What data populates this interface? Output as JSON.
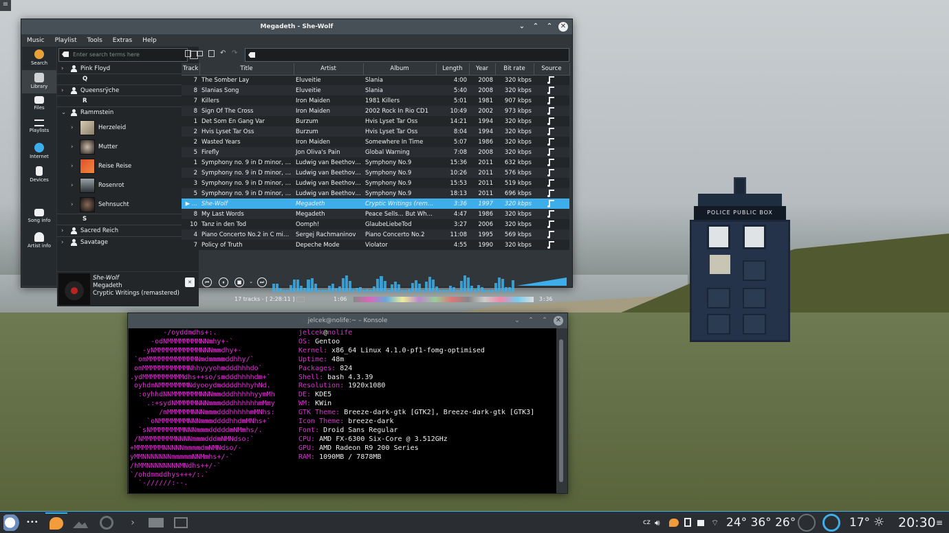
{
  "desktop": {
    "corner_menu": "≡"
  },
  "tardis": {
    "sign": "POLICE PUBLIC BOX"
  },
  "clementine": {
    "title": "Megadeth - She-Wolf",
    "menu": [
      "Music",
      "Playlist",
      "Tools",
      "Extras",
      "Help"
    ],
    "sidebar": [
      {
        "label": "Search",
        "icon": "search-icon",
        "color": "#e8a13a"
      },
      {
        "label": "Library",
        "icon": "library-icon",
        "color": "#cfd3d6"
      },
      {
        "label": "Files",
        "icon": "folder-icon",
        "color": "#eff0f1"
      },
      {
        "label": "Playlists",
        "icon": "playlist-icon",
        "color": "#eff0f1"
      },
      {
        "label": "Internet",
        "icon": "globe-icon",
        "color": "#3daee9"
      },
      {
        "label": "Devices",
        "icon": "devices-icon",
        "color": "#eff0f1"
      },
      {
        "label": "Song info",
        "icon": "song-info-icon",
        "color": "#eff0f1"
      },
      {
        "label": "Artist info",
        "icon": "artist-info-icon",
        "color": "#eff0f1"
      }
    ],
    "search_placeholder": "Enter search terms here",
    "tree": {
      "artist1": "Pink Floyd",
      "letter_q": "Q",
      "artist2": "Queensrÿche",
      "letter_r": "R",
      "artist3": "Rammstein",
      "albums": [
        "Herzeleid",
        "Mutter",
        "Reise Reise",
        "Rosenrot",
        "Sehnsucht"
      ],
      "letter_s": "S",
      "artist4": "Sacred Reich",
      "artist5": "Savatage"
    },
    "nowplaying": {
      "title": "She-Wolf",
      "artist": "Megadeth",
      "album": "Cryptic Writings (remastered)"
    },
    "columns": [
      "Track",
      "Title",
      "Artist",
      "Album",
      "Length",
      "Year",
      "Bit rate",
      "Source"
    ],
    "rows": [
      {
        "track": "7",
        "title": "The Somber Lay",
        "artist": "Eluveitie",
        "album": "Slania",
        "length": "4:00",
        "year": "2008",
        "bitrate": "320 kbps"
      },
      {
        "track": "8",
        "title": "Slanias Song",
        "artist": "Eluveitie",
        "album": "Slania",
        "length": "5:40",
        "year": "2008",
        "bitrate": "320 kbps"
      },
      {
        "track": "7",
        "title": "Killers",
        "artist": "Iron Maiden",
        "album": "1981 Killers",
        "length": "5:01",
        "year": "1981",
        "bitrate": "907 kbps"
      },
      {
        "track": "8",
        "title": "Sign Of The Cross",
        "artist": "Iron Maiden",
        "album": "2002 Rock In Rio CD1",
        "length": "10:49",
        "year": "2002",
        "bitrate": "973 kbps"
      },
      {
        "track": "1",
        "title": "Det Som En Gang Var",
        "artist": "Burzum",
        "album": "Hvis Lyset Tar Oss",
        "length": "14:21",
        "year": "1994",
        "bitrate": "320 kbps"
      },
      {
        "track": "2",
        "title": "Hvis Lyset Tar Oss",
        "artist": "Burzum",
        "album": "Hvis Lyset Tar Oss",
        "length": "8:04",
        "year": "1994",
        "bitrate": "320 kbps"
      },
      {
        "track": "2",
        "title": "Wasted Years",
        "artist": "Iron Maiden",
        "album": "Somewhere In Time",
        "length": "5:07",
        "year": "1986",
        "bitrate": "320 kbps"
      },
      {
        "track": "5",
        "title": "Firefly",
        "artist": "Jon Oliva's Pain",
        "album": "Global Warning",
        "length": "7:08",
        "year": "2008",
        "bitrate": "320 kbps"
      },
      {
        "track": "1",
        "title": "Symphony no. 9 in D minor, o...",
        "artist": "Ludwig van Beethoven",
        "album": "Symphony No.9",
        "length": "15:36",
        "year": "2011",
        "bitrate": "632 kbps"
      },
      {
        "track": "2",
        "title": "Symphony no. 9 in D minor, o...",
        "artist": "Ludwig van Beethoven",
        "album": "Symphony No.9",
        "length": "10:26",
        "year": "2011",
        "bitrate": "576 kbps"
      },
      {
        "track": "3",
        "title": "Symphony no. 9 in D minor, o...",
        "artist": "Ludwig van Beethoven",
        "album": "Symphony No.9",
        "length": "15:53",
        "year": "2011",
        "bitrate": "519 kbps"
      },
      {
        "track": "5",
        "title": "Symphony no. 9 in D minor, o...",
        "artist": "Ludwig van Beethoven",
        "album": "Symphony No.9",
        "length": "18:13",
        "year": "2011",
        "bitrate": "696 kbps"
      },
      {
        "track": "▶ ...",
        "title": "She-Wolf",
        "artist": "Megadeth",
        "album": "Cryptic Writings (rema...",
        "length": "3:36",
        "year": "1997",
        "bitrate": "320 kbps",
        "current": true
      },
      {
        "track": "8",
        "title": "My Last Words",
        "artist": "Megadeth",
        "album": "Peace Sells... But Who'...",
        "length": "4:47",
        "year": "1986",
        "bitrate": "320 kbps"
      },
      {
        "track": "10",
        "title": "Tanz in den Tod",
        "artist": "Oomph!",
        "album": "GlaubeLiebeTod",
        "length": "3:27",
        "year": "2006",
        "bitrate": "320 kbps"
      },
      {
        "track": "4",
        "title": "Piano Concerto No.2 in C min...",
        "artist": "Sergej Rachmaninov",
        "album": "Piano Concerto No.2",
        "length": "11:08",
        "year": "1995",
        "bitrate": "569 kbps"
      },
      {
        "track": "7",
        "title": "Policy of Truth",
        "artist": "Depeche Mode",
        "album": "Violator",
        "length": "4:55",
        "year": "1990",
        "bitrate": "320 kbps"
      }
    ],
    "status": "17 tracks - [ 2:28:11 ]",
    "elapsed": "1:06",
    "total": "3:36",
    "accent": "#3daee9"
  },
  "konsole": {
    "title": "jelcek@nolife:~ – Konsole",
    "logo": [
      "        -/oyddmdhs+:.",
      "     -odNMMMMMMMMNNmhy+-`",
      "   -yNMMMMMMMMMMMNNNmmdhy+-",
      " `omMMMMMMMMMMMMNmdmmmmddhhy/`",
      " omMMMMMMMMMMMNhhyyyohmdddhhhdo`",
      ".ydMMMMMMMMMMdhs++so/smdddhhhhdm+`",
      " oyhdmNMMMMMMMNdyooydmddddhhhyhNd.",
      "  :oyhhdNNMMMMMMMNNNmmdddhhhhhyymMh",
      "    .:+sydNMMMMMNNNmmmdddhhhhhhmMmy",
      "       /mMMMMMMNNNmmmdddhhhhhmMNhs:",
      "    `oNMMMMMMMNNNmmmddddhhdmMNhs+`",
      "  `sNMMMMMMMMNNNmmmdddddmNMmhs/.",
      " /NMMMMMMMMNNNNmmmdddmNMNdso:`",
      "+MMMMMMMNNNNNmmmmdmNMNdso/-",
      "yMMNNNNNNNmmmmmNNMmhs+/-`",
      "/hMMNNNNNNNNMNdhs++/-`",
      "`/ohdmmddhys+++/:.`",
      "  `-//////:--."
    ],
    "info": [
      {
        "key": "",
        "val": "jelcek@nolife",
        "key_colored": "jelcek",
        "host": "nolife"
      },
      {
        "key": "OS:",
        "val": " Gentoo"
      },
      {
        "key": "Kernel:",
        "val": " x86_64 Linux 4.1.0-pf1-fomg-optimised"
      },
      {
        "key": "Uptime:",
        "val": " 48m"
      },
      {
        "key": "Packages:",
        "val": " 824"
      },
      {
        "key": "Shell:",
        "val": " bash 4.3.39"
      },
      {
        "key": "Resolution:",
        "val": " 1920x1080"
      },
      {
        "key": "DE:",
        "val": " KDE5"
      },
      {
        "key": "WM:",
        "val": " KWin"
      },
      {
        "key": "GTK Theme:",
        "val": " Breeze-dark-gtk [GTK2], Breeze-dark-gtk [GTK3]"
      },
      {
        "key": "Icon Theme:",
        "val": " breeze-dark"
      },
      {
        "key": "Font:",
        "val": " Droid Sans Regular"
      },
      {
        "key": "CPU:",
        "val": " AMD FX-6300 Six-Core @ 3.512GHz"
      },
      {
        "key": "GPU:",
        "val": " AMD Radeon R9 200 Series"
      },
      {
        "key": "RAM:",
        "val": " 1090MB / 7878MB"
      }
    ]
  },
  "taskbar": {
    "dots": "•••",
    "lang": "cz",
    "temps": "24° 36° 26°",
    "weather_temp": "17°",
    "clock": "20:30",
    "menu": "≡"
  }
}
